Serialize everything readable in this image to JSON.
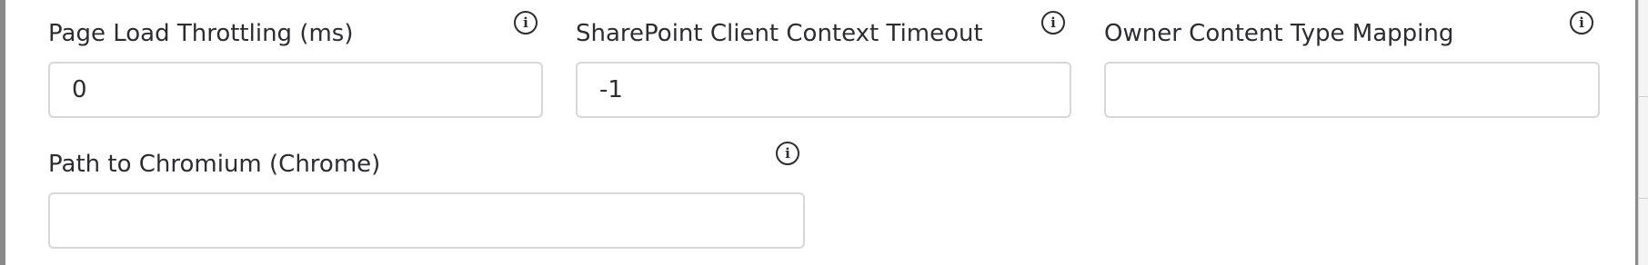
{
  "fields": [
    {
      "label": "Page Load Throttling (ms)",
      "value": "0",
      "info_icon": "info-circle-icon"
    },
    {
      "label": "SharePoint Client Context Timeout",
      "value": "-1",
      "info_icon": "info-circle-icon"
    },
    {
      "label": "Owner Content Type Mapping",
      "value": "",
      "info_icon": "info-circle-icon"
    },
    {
      "label": "Path to Chromium (Chrome)",
      "value": "",
      "info_icon": "info-circle-icon"
    }
  ],
  "info_glyph": "i",
  "colors": {
    "text": "#2b2d33",
    "input_border": "#d6d7db",
    "panel_background": "#ffffff",
    "overlay": "#8a8a8a"
  }
}
